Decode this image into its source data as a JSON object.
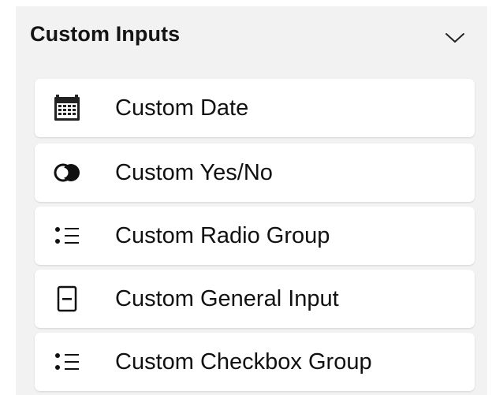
{
  "panel": {
    "title": "Custom Inputs",
    "collapse_icon": "chevron-down-icon",
    "background": "#f2f2f3",
    "items": [
      {
        "label": "Custom Date",
        "icon": "calendar-icon"
      },
      {
        "label": "Custom Yes/No",
        "icon": "toggle-circles-icon"
      },
      {
        "label": "Custom Radio Group",
        "icon": "radio-list-icon"
      },
      {
        "label": "Custom General Input",
        "icon": "input-box-icon"
      },
      {
        "label": "Custom Checkbox Group",
        "icon": "checkbox-list-icon"
      }
    ]
  }
}
